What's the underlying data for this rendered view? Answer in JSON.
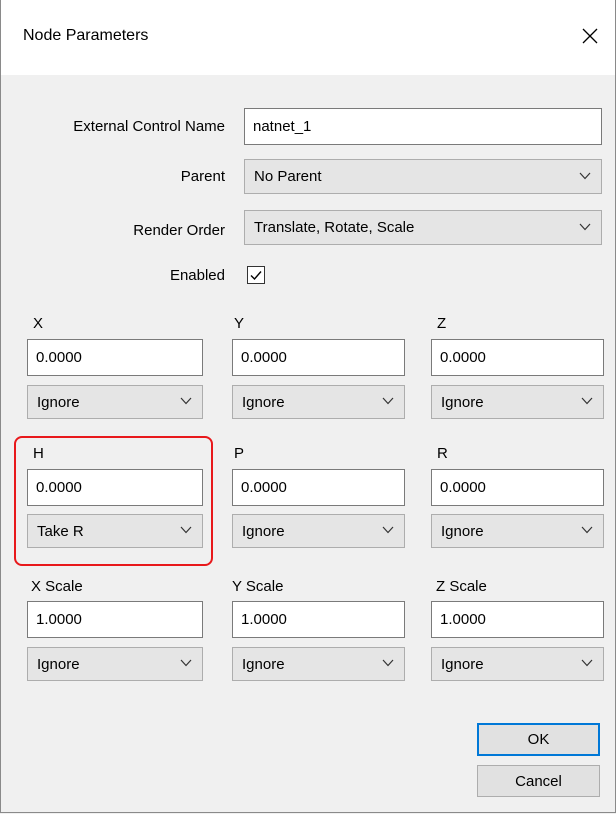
{
  "window": {
    "title": "Node Parameters"
  },
  "form": {
    "external_control_name": {
      "label": "External Control Name",
      "value": "natnet_1"
    },
    "parent": {
      "label": "Parent",
      "value": "No Parent"
    },
    "render_order": {
      "label": "Render Order",
      "value": "Translate, Rotate, Scale"
    },
    "enabled": {
      "label": "Enabled",
      "checked": true
    }
  },
  "fields": {
    "x": {
      "label": "X",
      "value": "0.0000",
      "mode": "Ignore"
    },
    "y": {
      "label": "Y",
      "value": "0.0000",
      "mode": "Ignore"
    },
    "z": {
      "label": "Z",
      "value": "0.0000",
      "mode": "Ignore"
    },
    "h": {
      "label": "H",
      "value": "0.0000",
      "mode": "Take R"
    },
    "p": {
      "label": "P",
      "value": "0.0000",
      "mode": "Ignore"
    },
    "r": {
      "label": "R",
      "value": "0.0000",
      "mode": "Ignore"
    },
    "x_scale": {
      "label": "X Scale",
      "value": "1.0000",
      "mode": "Ignore"
    },
    "y_scale": {
      "label": "Y Scale",
      "value": "1.0000",
      "mode": "Ignore"
    },
    "z_scale": {
      "label": "Z Scale",
      "value": "1.0000",
      "mode": "Ignore"
    }
  },
  "buttons": {
    "ok": "OK",
    "cancel": "Cancel"
  },
  "colors": {
    "highlight": "#e8181b",
    "default_button_border": "#0078d7"
  }
}
